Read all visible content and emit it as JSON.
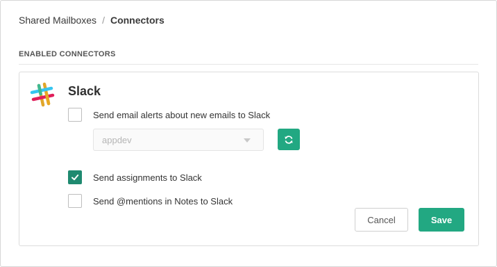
{
  "breadcrumb": {
    "parent": "Shared Mailboxes",
    "separator": "/",
    "current": "Connectors"
  },
  "section": {
    "title": "ENABLED CONNECTORS"
  },
  "connector": {
    "name": "Slack",
    "logo_icon": "slack-logo-icon",
    "options": [
      {
        "label": "Send email alerts about new emails to Slack",
        "checked": false
      },
      {
        "label": "Send assignments to Slack",
        "checked": true
      },
      {
        "label": "Send @mentions in Notes to Slack",
        "checked": false
      }
    ],
    "channel_select": {
      "value": "appdev"
    },
    "refresh_icon": "refresh-icon"
  },
  "actions": {
    "cancel_label": "Cancel",
    "save_label": "Save"
  },
  "colors": {
    "accent": "#22a882",
    "checkbox_checked": "#1f8a70"
  }
}
